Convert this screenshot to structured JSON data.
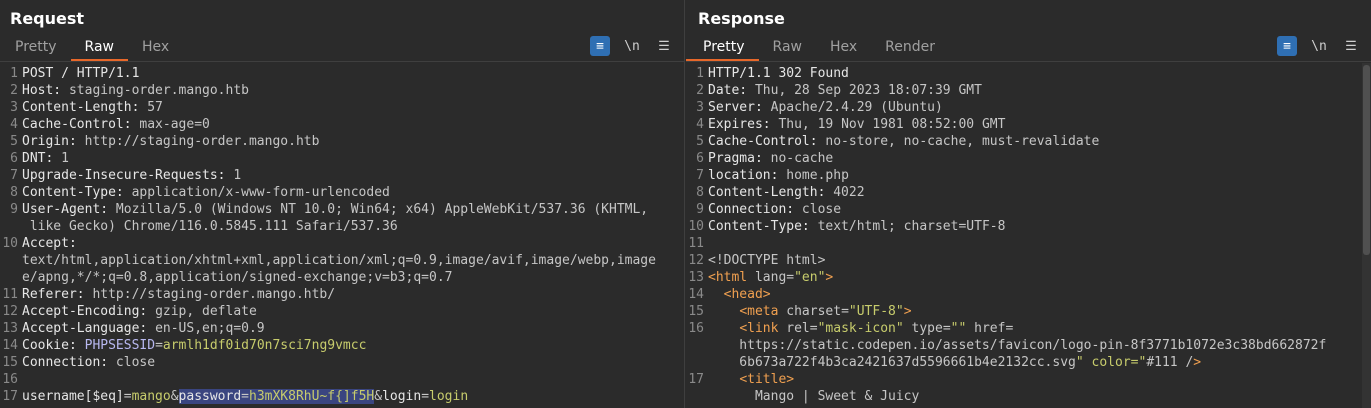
{
  "request": {
    "title": "Request",
    "tabs": [
      "Pretty",
      "Raw",
      "Hex"
    ],
    "active_tab": "Raw",
    "tools": {
      "wrap": "≡",
      "newline": "\\n",
      "menu": "☰"
    },
    "lines": [
      {
        "n": "1",
        "t": "POST / HTTP/1.1"
      },
      {
        "n": "2",
        "k": "Host",
        "v": "staging-order.mango.htb"
      },
      {
        "n": "3",
        "k": "Content-Length",
        "v": "57"
      },
      {
        "n": "4",
        "k": "Cache-Control",
        "v": "max-age=0"
      },
      {
        "n": "5",
        "k": "Origin",
        "v": "http://staging-order.mango.htb"
      },
      {
        "n": "6",
        "k": "DNT",
        "v": "1"
      },
      {
        "n": "7",
        "k": "Upgrade-Insecure-Requests",
        "v": "1"
      },
      {
        "n": "8",
        "k": "Content-Type",
        "v": "application/x-www-form-urlencoded"
      },
      {
        "n": "9",
        "k": "User-Agent",
        "v": "Mozilla/5.0 (Windows NT 10.0; Win64; x64) AppleWebKit/537.36 (KHTML,",
        "cont": " like Gecko) Chrome/116.0.5845.111 Safari/537.36"
      },
      {
        "n": "10",
        "k": "Accept",
        "v": "",
        "cont2": "text/html,application/xhtml+xml,application/xml;q=0.9,image/avif,image/webp,image",
        "cont3": "e/apng,*/*;q=0.8,application/signed-exchange;v=b3;q=0.7"
      },
      {
        "n": "11",
        "k": "Referer",
        "v": "http://staging-order.mango.htb/"
      },
      {
        "n": "12",
        "k": "Accept-Encoding",
        "v": "gzip, deflate"
      },
      {
        "n": "13",
        "k": "Accept-Language",
        "v": "en-US,en;q=0.9"
      },
      {
        "n": "14",
        "k": "Cookie",
        "cookie_name": "PHPSESSID",
        "cookie_val": "armlh1df0id70n7sci7ng9vmcc"
      },
      {
        "n": "15",
        "k": "Connection",
        "v": "close"
      },
      {
        "n": "16",
        "t": ""
      },
      {
        "n": "17",
        "body": {
          "p1": "username[$eq]",
          "v1": "mango",
          "p2": "password",
          "v2": "h3mXK8RhU~f{]f5H",
          "p3": "login",
          "v3": "login"
        }
      }
    ]
  },
  "response": {
    "title": "Response",
    "tabs": [
      "Pretty",
      "Raw",
      "Hex",
      "Render"
    ],
    "active_tab": "Pretty",
    "tools": {
      "wrap": "≡",
      "newline": "\\n",
      "menu": "☰"
    },
    "lines": [
      {
        "n": "1",
        "t": "HTTP/1.1 302 Found"
      },
      {
        "n": "2",
        "k": "Date",
        "v": "Thu, 28 Sep 2023 18:07:39 GMT"
      },
      {
        "n": "3",
        "k": "Server",
        "v": "Apache/2.4.29 (Ubuntu)"
      },
      {
        "n": "4",
        "k": "Expires",
        "v": "Thu, 19 Nov 1981 08:52:00 GMT"
      },
      {
        "n": "5",
        "k": "Cache-Control",
        "v": "no-store, no-cache, must-revalidate"
      },
      {
        "n": "6",
        "k": "Pragma",
        "v": "no-cache"
      },
      {
        "n": "7",
        "k": "location",
        "v": "home.php"
      },
      {
        "n": "8",
        "k": "Content-Length",
        "v": "4022"
      },
      {
        "n": "9",
        "k": "Connection",
        "v": "close"
      },
      {
        "n": "10",
        "k": "Content-Type",
        "v": "text/html; charset=UTF-8"
      },
      {
        "n": "11",
        "t": ""
      },
      {
        "n": "12",
        "t": "<!DOCTYPE html>"
      },
      {
        "n": "13",
        "html": "<html lang=\"en\">"
      },
      {
        "n": "14",
        "html": "  <head>"
      },
      {
        "n": "15",
        "html": "    <meta charset=\"UTF-8\">"
      },
      {
        "n": "16",
        "html": "    <link rel=\"mask-icon\" type=\"\" href=\"",
        "cont": "    https://static.codepen.io/assets/favicon/logo-pin-8f3771b1072e3c38bd662872f",
        "cont2": "    6b673a722f4b3ca2421637d5596661b4e2132cc.svg\" color=\"#111\" />"
      },
      {
        "n": "17",
        "html": "    <title>",
        "cont": "      Mango | Sweet & Juicy"
      }
    ]
  },
  "colors": {
    "accent": "#e8682a",
    "wrap_active": "#2f6fb3",
    "highlight": "#3a4580"
  }
}
